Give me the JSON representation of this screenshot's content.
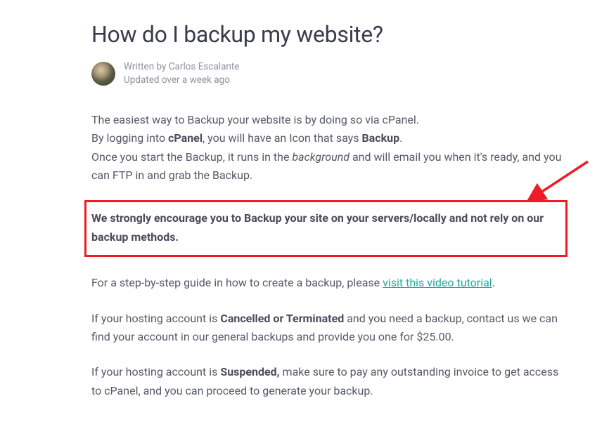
{
  "title": "How do I backup my website?",
  "author": {
    "written_by_prefix": "Written by ",
    "name": "Carlos Escalante",
    "updated": "Updated over a week ago"
  },
  "body": {
    "p1_a": "The easiest way to Backup your website is by doing so via cPanel.",
    "p1_b_pre": "By logging into ",
    "p1_b_bold": "cPanel",
    "p1_b_mid": ", you will have an Icon that says ",
    "p1_b_bold2": "Backup",
    "p1_b_post": ".",
    "p1_c_pre": "Once you start the Backup, it runs in the ",
    "p1_c_em": "background",
    "p1_c_post": " and will email you when it's ready, and you can FTP in and grab the Backup.",
    "highlight": "We strongly encourage you to Backup your site on your servers/locally and not rely on our backup methods.",
    "p2_pre": "For a step-by-step guide in how to create a backup, please ",
    "p2_link": "visit this video tutorial",
    "p2_post": ".",
    "p3_pre": "If your hosting account is ",
    "p3_bold": "Cancelled or Terminated",
    "p3_post": " and you need a backup, contact us we can find your account in our general backups and provide you one for $25.00.",
    "p4_pre": "If your hosting account is ",
    "p4_bold": "Suspended,",
    "p4_post": " make sure to pay any outstanding invoice to get access to cPanel, and you can proceed to generate your backup."
  },
  "colors": {
    "highlight_border": "#ed1c24",
    "link": "#1aae9f"
  }
}
